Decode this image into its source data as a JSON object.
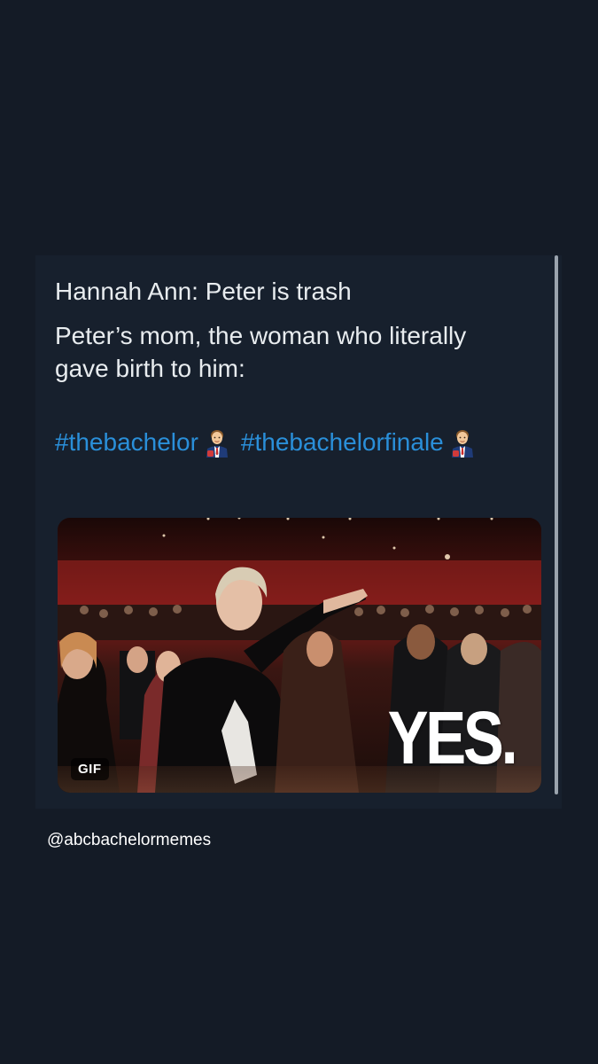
{
  "tweet": {
    "line_1": "Hannah Ann: Peter is trash",
    "line_2": "Peter’s mom, the woman who literally",
    "line_3": "gave birth to him:",
    "hashtags": [
      "#thebachelor",
      "#thebachelorfinale"
    ],
    "hashtag_emoji": "man-in-suit-emoji",
    "hashtag_color": "#2a8fd9",
    "text_color": "#e8ecef",
    "card_color": "#17202d"
  },
  "media": {
    "badge": "GIF",
    "caption": "YES."
  },
  "footer": {
    "handle": "@abcbachelormemes"
  },
  "background_color": "#141b26"
}
